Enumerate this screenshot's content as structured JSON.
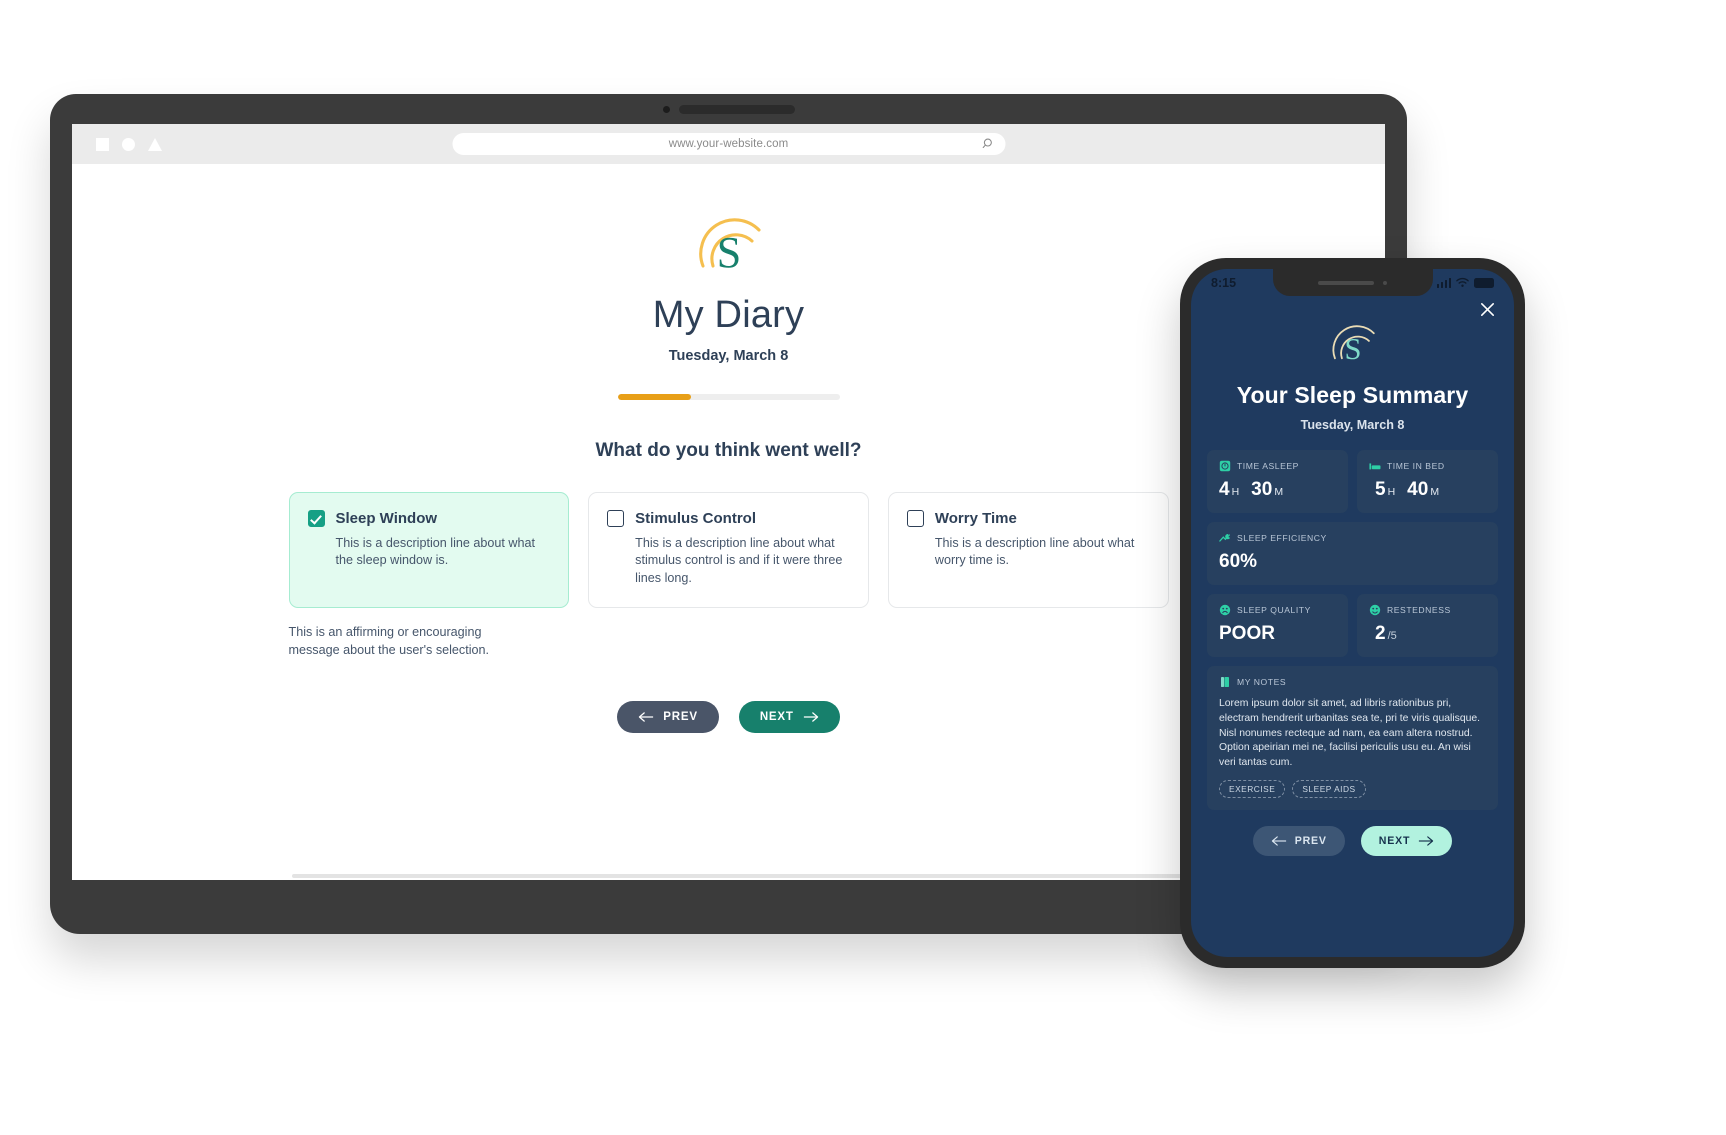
{
  "browser": {
    "url": "www.your-website.com",
    "search_icon": "search-icon",
    "window_buttons": [
      "square",
      "circle",
      "triangle"
    ]
  },
  "desktop": {
    "logo_icon": "sleepio-s-logo",
    "title": "My Diary",
    "date": "Tuesday, March 8",
    "progress": {
      "percent": 33,
      "fill_color": "#e89f17",
      "track_color": "#eeeeee"
    },
    "question": "What do you think went well?",
    "cards": [
      {
        "title": "Sleep Window",
        "description": "This is a description line about what the sleep window is.",
        "checked": true
      },
      {
        "title": "Stimulus Control",
        "description": "This is a description line about what stimulus control is and if it were three lines long.",
        "checked": false
      },
      {
        "title": "Worry Time",
        "description": "This is a description line about what worry time is.",
        "checked": false
      }
    ],
    "affirm_line1": "This is an affirming or encouraging",
    "affirm_line2": "message about the user's selection.",
    "prev_label": "PREV",
    "next_label": "NEXT"
  },
  "phone": {
    "status": {
      "time": "8:15",
      "signal_icon": "cellular-bars-icon",
      "wifi_icon": "wifi-icon",
      "battery_icon": "battery-icon"
    },
    "close_label": "close-icon",
    "logo_icon": "sleepio-s-logo",
    "title": "Your Sleep Summary",
    "date": "Tuesday, March 8",
    "stats": [
      {
        "label": "TIME ASLEEP",
        "icon": "clock-icon",
        "value": "4",
        "unit": "H",
        "value2": "30",
        "unit2": "M"
      },
      {
        "label": "TIME IN BED",
        "icon": "bed-icon",
        "value": "5",
        "unit": "H",
        "value2": "40",
        "unit2": "M"
      },
      {
        "label": "SLEEP EFFICIENCY",
        "icon": "moon-icon",
        "value": "60%",
        "unit": "",
        "value2": "",
        "unit2": ""
      },
      {
        "label": "SLEEP QUALITY",
        "icon": "face-sad-icon",
        "value": "POOR",
        "unit": "",
        "value2": "",
        "unit2": ""
      },
      {
        "label": "RESTEDNESS",
        "icon": "face-smile-icon",
        "value": "2",
        "unit": "/5",
        "value2": "",
        "unit2": ""
      }
    ],
    "notes": {
      "label": "MY NOTES",
      "icon": "note-icon",
      "text": "Lorem ipsum dolor sit amet, ad libris rationibus pri, electram hendrerit urbanitas sea te, pri te viris qualisque. Nisl nonumes recteque ad nam, ea eam altera nostrud. Option apeirian mei ne, facilisi periculis usu eu. An wisi veri tantas cum.",
      "tags": [
        "EXERCISE",
        "SLEEP AIDS"
      ]
    },
    "prev_label": "PREV",
    "next_label": "NEXT"
  }
}
